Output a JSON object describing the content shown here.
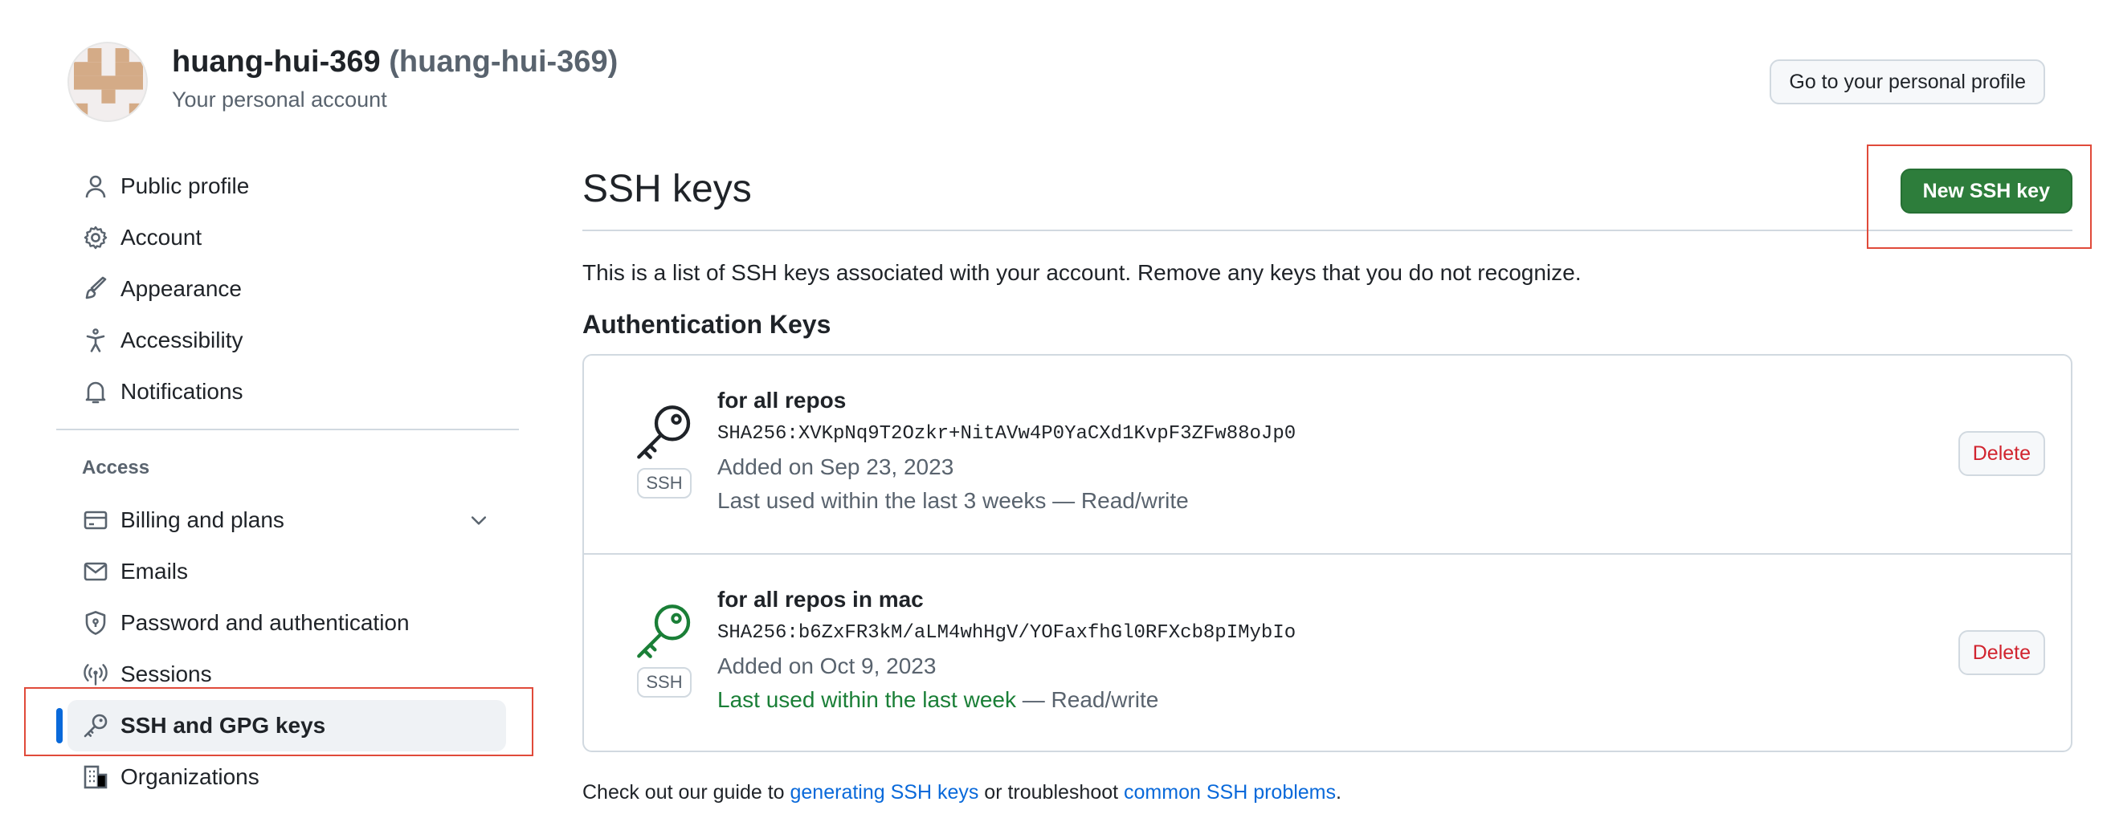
{
  "header": {
    "username": "huang-hui-369",
    "handle": "(huang-hui-369)",
    "subtitle": "Your personal account",
    "profile_button": "Go to your personal profile"
  },
  "sidebar": {
    "items": [
      {
        "label": "Public profile",
        "icon": "person-icon"
      },
      {
        "label": "Account",
        "icon": "gear-icon"
      },
      {
        "label": "Appearance",
        "icon": "paintbrush-icon"
      },
      {
        "label": "Accessibility",
        "icon": "accessibility-icon"
      },
      {
        "label": "Notifications",
        "icon": "bell-icon"
      }
    ],
    "access_heading": "Access",
    "access_items": [
      {
        "label": "Billing and plans",
        "icon": "credit-card-icon"
      },
      {
        "label": "Emails",
        "icon": "mail-icon"
      },
      {
        "label": "Password and authentication",
        "icon": "shield-lock-icon"
      },
      {
        "label": "Sessions",
        "icon": "broadcast-icon"
      },
      {
        "label": "SSH and GPG keys",
        "icon": "key-icon",
        "active": true
      },
      {
        "label": "Organizations",
        "icon": "organization-icon"
      }
    ]
  },
  "main": {
    "title": "SSH keys",
    "new_button": "New SSH key",
    "intro": "This is a list of SSH keys associated with your account. Remove any keys that you do not recognize.",
    "section_title": "Authentication Keys",
    "keys": [
      {
        "title": "for all repos",
        "fingerprint": "SHA256:XVKpNq9T2Ozkr+NitAVw4P0YaCXd1KvpF3ZFw88oJp0",
        "added": "Added on Sep 23, 2023",
        "last_used": "Last used within the last 3 weeks",
        "access": " — Read/write",
        "badge": "SSH",
        "delete": "Delete",
        "recent": false
      },
      {
        "title": "for all repos in mac",
        "fingerprint": "SHA256:b6ZxFR3kM/aLM4whHgV/YOFaxfhGl0RFXcb8pIMybIo",
        "added": "Added on Oct 9, 2023",
        "last_used": "Last used within the last week",
        "access": " — Read/write",
        "badge": "SSH",
        "delete": "Delete",
        "recent": true
      }
    ],
    "footer": {
      "prefix": "Check out our guide to ",
      "link1": "generating SSH keys",
      "middle": " or troubleshoot ",
      "link2": "common SSH problems",
      "suffix": "."
    }
  },
  "colors": {
    "accent": "#0969da",
    "primary_button": "#2d7d3b",
    "danger": "#d1242f",
    "recent_green": "#1a7f37",
    "highlight_box": "#e04a3a"
  }
}
